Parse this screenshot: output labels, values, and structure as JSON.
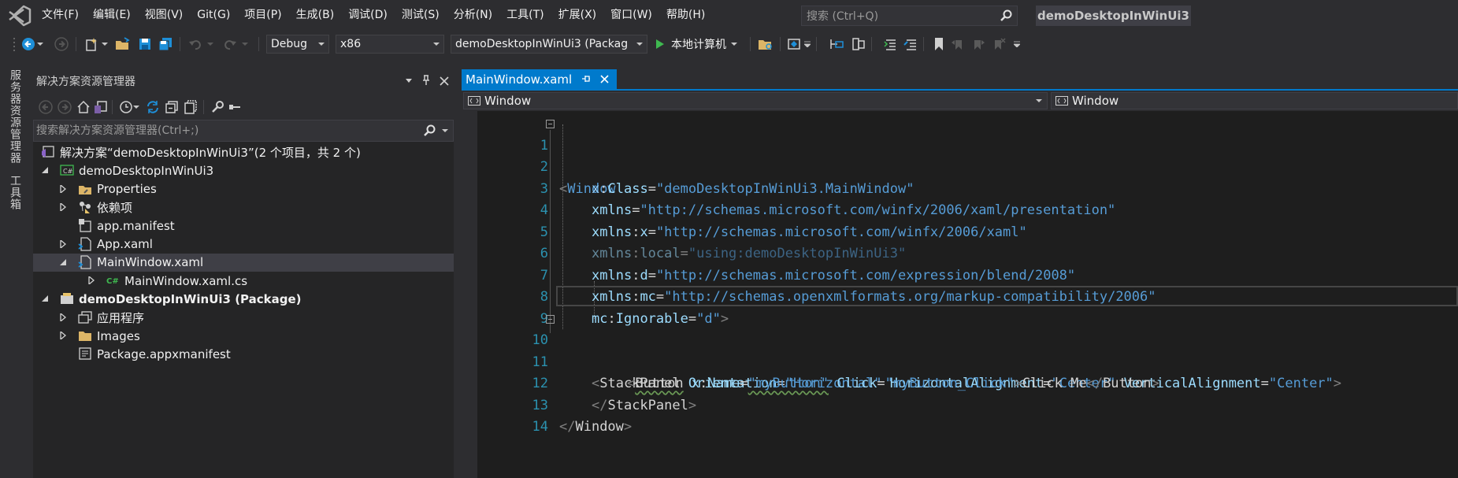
{
  "menubar": {
    "items": [
      "文件(F)",
      "编辑(E)",
      "视图(V)",
      "Git(G)",
      "项目(P)",
      "生成(B)",
      "调试(D)",
      "测试(S)",
      "分析(N)",
      "工具(T)",
      "扩展(X)",
      "窗口(W)",
      "帮助(H)"
    ],
    "search_placeholder": "搜索 (Ctrl+Q)",
    "solution_name": "demoDesktopInWinUi3"
  },
  "toolbar": {
    "configuration": "Debug",
    "platform": "x86",
    "startup_project": "demoDesktopInWinUi3 (Packag",
    "run_label": "本地计算机"
  },
  "side_tabs": {
    "server_explorer": "服务器资源管理器",
    "toolbox": "工具箱"
  },
  "solution_explorer": {
    "title": "解决方案资源管理器",
    "search_placeholder": "搜索解决方案资源管理器(Ctrl+;)",
    "tree": [
      {
        "label": "解决方案“demoDesktopInWinUi3”(2 个项目，共 2 个)",
        "level": 0,
        "icon": "solution-icon",
        "expander": "none",
        "bold": false,
        "selected": false
      },
      {
        "label": "demoDesktopInWinUi3",
        "level": 1,
        "icon": "csharp-project-icon",
        "expander": "expanded",
        "bold": false,
        "selected": false
      },
      {
        "label": "Properties",
        "level": 2,
        "icon": "properties-folder-icon",
        "expander": "collapsed",
        "bold": false,
        "selected": false
      },
      {
        "label": "依赖项",
        "level": 2,
        "icon": "dependencies-icon",
        "expander": "collapsed",
        "bold": false,
        "selected": false
      },
      {
        "label": "app.manifest",
        "level": 2,
        "icon": "manifest-file-icon",
        "expander": "none",
        "bold": false,
        "selected": false
      },
      {
        "label": "App.xaml",
        "level": 2,
        "icon": "xaml-file-icon",
        "expander": "collapsed",
        "bold": false,
        "selected": false
      },
      {
        "label": "MainWindow.xaml",
        "level": 2,
        "icon": "xaml-file-icon",
        "expander": "expanded",
        "bold": false,
        "selected": true
      },
      {
        "label": "MainWindow.xaml.cs",
        "level": 3,
        "icon": "csharp-file-icon",
        "expander": "collapsed",
        "bold": false,
        "selected": false
      },
      {
        "label": "demoDesktopInWinUi3 (Package)",
        "level": 1,
        "icon": "package-project-icon",
        "expander": "expanded",
        "bold": true,
        "selected": false
      },
      {
        "label": "应用程序",
        "level": 2,
        "icon": "applications-icon",
        "expander": "collapsed",
        "bold": false,
        "selected": false
      },
      {
        "label": "Images",
        "level": 2,
        "icon": "folder-icon",
        "expander": "collapsed",
        "bold": false,
        "selected": false
      },
      {
        "label": "Package.appxmanifest",
        "level": 2,
        "icon": "appxmanifest-icon",
        "expander": "none",
        "bold": false,
        "selected": false
      }
    ]
  },
  "editor": {
    "tab_title": "MainWindow.xaml",
    "nav_left": "Window",
    "nav_right": "Window",
    "line_numbers": [
      "1",
      "2",
      "3",
      "4",
      "5",
      "6",
      "7",
      "8",
      "9",
      "10",
      "11",
      "12",
      "13",
      "14"
    ],
    "code": {
      "l1": {
        "open": "<",
        "tag": "Window"
      },
      "l2": {
        "prefix": "x",
        "colon": ":",
        "attr": "Class",
        "eq": "=",
        "value": "\"demoDesktopInWinUi3.MainWindow\""
      },
      "l3": {
        "attr": "xmlns",
        "eq": "=",
        "value": "\"http://schemas.microsoft.com/winfx/2006/xaml/presentation\""
      },
      "l4": {
        "prefix": "xmlns",
        "colon": ":",
        "attr": "x",
        "eq": "=",
        "value": "\"http://schemas.microsoft.com/winfx/2006/xaml\""
      },
      "l5": {
        "prefix": "xmlns",
        "colon": ":",
        "attr": "local",
        "eq": "=",
        "value": "\"using:demoDesktopInWinUi3\""
      },
      "l6": {
        "prefix": "xmlns",
        "colon": ":",
        "attr": "d",
        "eq": "=",
        "value": "\"http://schemas.microsoft.com/expression/blend/2008\""
      },
      "l7": {
        "prefix": "xmlns",
        "colon": ":",
        "attr": "mc",
        "eq": "=",
        "value": "\"http://schemas.openxmlformats.org/markup-compatibility/2006\""
      },
      "l8": {
        "prefix": "mc",
        "colon": ":",
        "attr": "Ignorable",
        "eq": "=",
        "value": "\"d\"",
        "close": ">"
      },
      "l10": {
        "open": "<",
        "tag": "StackPanel",
        "a1": "Orientation",
        "v1": "\"Horizontal\"",
        "a2": "HorizontalAlignment",
        "v2": "\"Center\"",
        "a3": "VerticalAlignment",
        "v3": "\"Center\"",
        "close": ">",
        "eq": "="
      },
      "l11": {
        "open": "<",
        "tag": "Button",
        "p1": "x",
        "colon": ":",
        "a1": "Name",
        "v1": "\"myButton\"",
        "a2": "Click",
        "v2": "\"myButton_Click\"",
        "close": ">",
        "text": "Click Me",
        "end_open": "</",
        "end_tag": "Button",
        "end_close": ">",
        "eq": "="
      },
      "l12": {
        "open": "</",
        "tag": "StackPanel",
        "close": ">"
      },
      "l13": {
        "open": "</",
        "tag": "Window",
        "close": ">"
      }
    }
  }
}
